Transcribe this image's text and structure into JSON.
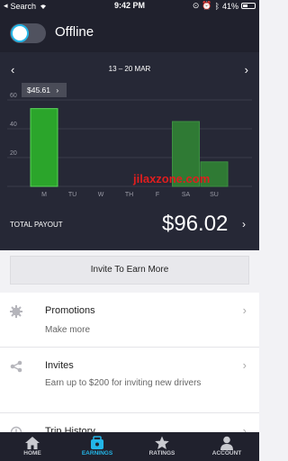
{
  "status_bar": {
    "carrier": "Search",
    "time": "9:42 PM",
    "battery": "41%",
    "battery_level": 0.41
  },
  "header": {
    "status": "Offline"
  },
  "earnings": {
    "range": "13 – 20 MAR",
    "selected_amount": "$45.61",
    "payout_label": "TOTAL PAYOUT",
    "payout_value": "$96.02",
    "watermark": "jilaxzone.com"
  },
  "chart_data": {
    "type": "bar",
    "categories": [
      "M",
      "TU",
      "W",
      "TH",
      "F",
      "SA",
      "SU"
    ],
    "values": [
      54,
      0,
      0,
      0,
      0,
      45,
      17
    ],
    "ylim": [
      0,
      70
    ],
    "yticks": [
      20,
      40,
      60
    ],
    "colors": {
      "selected": "#2ba52b",
      "normal": "#2f7a34"
    }
  },
  "invite_button": "Invite To Earn More",
  "list": [
    {
      "title": "Promotions",
      "subtitle": "Make more",
      "icon": "gear-icon"
    },
    {
      "title": "Invites",
      "subtitle": "Earn up to $200 for inviting new drivers",
      "icon": "share-icon"
    },
    {
      "title": "Trip History",
      "subtitle": "",
      "icon": "history-icon"
    }
  ],
  "tabs": [
    {
      "label": "HOME",
      "icon": "home-icon"
    },
    {
      "label": "EARNINGS",
      "icon": "wallet-icon"
    },
    {
      "label": "RATINGS",
      "icon": "star-icon"
    },
    {
      "label": "ACCOUNT",
      "icon": "account-icon"
    }
  ],
  "colors": {
    "accent": "#23b6e8",
    "dark_bg": "#20212d",
    "chart_bg": "#262836"
  }
}
